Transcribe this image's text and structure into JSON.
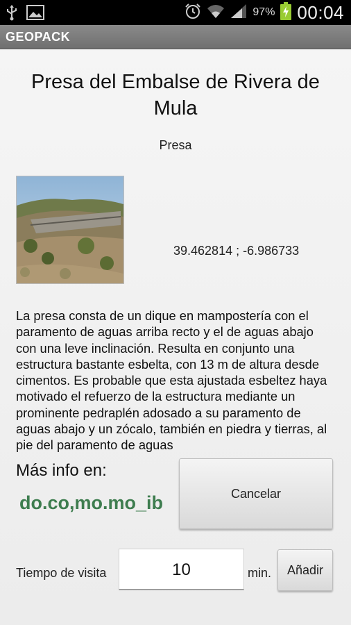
{
  "status_bar": {
    "icons": [
      "usb-icon",
      "image-icon",
      "alarm-icon",
      "wifi-icon",
      "signal-icon",
      "battery-charging-icon"
    ],
    "battery_percent": "97%",
    "time": "00:04"
  },
  "app_bar": {
    "title": "GEOPACK"
  },
  "place": {
    "title": "Presa del Embalse de Rivera de Mula",
    "type": "Presa",
    "coordinates": "39.462814 ; -6.986733",
    "description": "La presa consta de un dique en mampostería con el paramento de aguas arriba recto y el de aguas abajo con una leve inclinación. Resulta en conjunto una estructura bastante esbelta, con 13 m de altura desde cimentos. Es probable que esta ajustada esbeltez haya motivado el refuerzo de la estructura mediante un prominente pedraplén adosado a su paramento de aguas abajo y un zócalo, también en piedra y tierras, al pie del paramento de aguas"
  },
  "more_info": {
    "label": "Más info en:",
    "logo_text": "do.co,mo.mo_ib"
  },
  "buttons": {
    "cancel": "Cancelar",
    "add": "Añadir"
  },
  "visit": {
    "label": "Tiempo de visita",
    "value": "10",
    "unit": "min."
  },
  "colors": {
    "logo_green": "#3e7d4f",
    "title_bar": "#7a7a7a"
  }
}
